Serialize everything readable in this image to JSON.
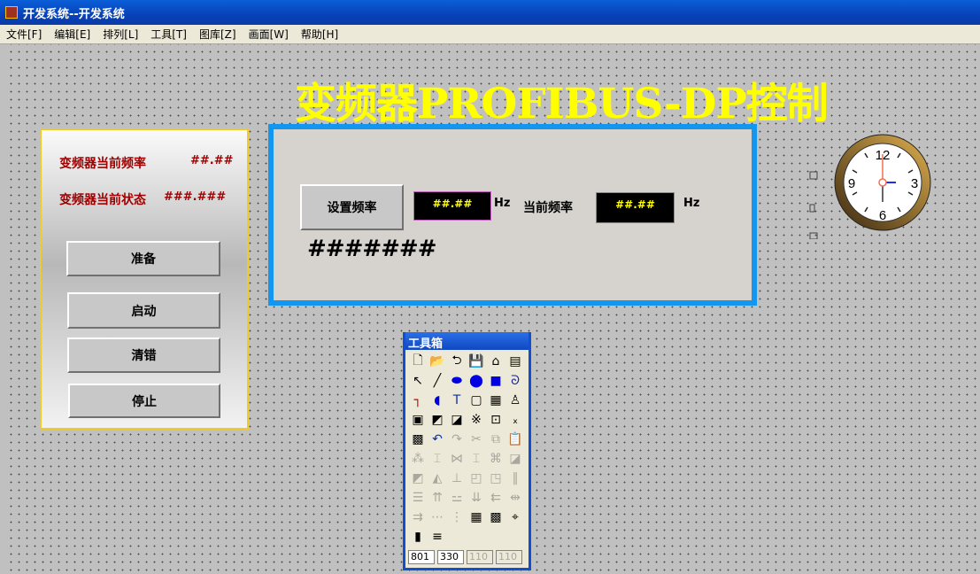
{
  "window": {
    "title": "开发系统--开发系统"
  },
  "menu": [
    "文件[F]",
    "编辑[E]",
    "排列[L]",
    "工具[T]",
    "图库[Z]",
    "画面[W]",
    "帮助[H]"
  ],
  "screen": {
    "title": "变频器PROFIBUS-DP控制"
  },
  "left_panel": {
    "freq_label": "变频器当前频率",
    "freq_value": "##.##",
    "status_label": "变频器当前状态",
    "status_value": "###.###",
    "buttons": [
      "准备",
      "启动",
      "清错",
      "停止"
    ]
  },
  "main_panel": {
    "set_button": "设置频率",
    "set_value": "##.##",
    "unit1": "Hz",
    "current_label": "当前频率",
    "current_value": "##.##",
    "unit2": "Hz",
    "message": "#######"
  },
  "clock": {
    "numbers": [
      "12",
      "3",
      "6",
      "9"
    ]
  },
  "toolbox": {
    "title": "工具箱",
    "fields": [
      "801",
      "330",
      "110",
      "110"
    ],
    "icons": [
      {
        "n": "new-icon",
        "g": "🗋",
        "d": false
      },
      {
        "n": "open-icon",
        "g": "📂",
        "d": true
      },
      {
        "n": "import-icon",
        "g": "⮌",
        "d": false
      },
      {
        "n": "save-icon",
        "g": "💾",
        "d": true
      },
      {
        "n": "screen-icon",
        "g": "⌂",
        "d": false
      },
      {
        "n": "window-icon",
        "g": "▤",
        "d": false
      },
      {
        "n": "pointer-icon",
        "g": "↖",
        "d": false
      },
      {
        "n": "line-icon",
        "g": "╱",
        "d": false
      },
      {
        "n": "ellipse-fill-icon",
        "g": "⬬",
        "d": false
      },
      {
        "n": "circle-icon",
        "g": "⬤",
        "d": false
      },
      {
        "n": "rectangle-icon",
        "g": "■",
        "d": false
      },
      {
        "n": "polyline-icon",
        "g": "ᘐ",
        "d": false
      },
      {
        "n": "pipe-icon",
        "g": "┐",
        "d": false
      },
      {
        "n": "arc-icon",
        "g": "◖",
        "d": false
      },
      {
        "n": "text-icon",
        "g": "T",
        "d": false
      },
      {
        "n": "rounded-rect-icon",
        "g": "▢",
        "d": false
      },
      {
        "n": "report-icon",
        "g": "▦",
        "d": false
      },
      {
        "n": "symbol-icon",
        "g": "♙",
        "d": false
      },
      {
        "n": "library-icon",
        "g": "▣",
        "d": false
      },
      {
        "n": "trend-icon",
        "g": "◩",
        "d": false
      },
      {
        "n": "xy-curve-icon",
        "g": "◪",
        "d": false
      },
      {
        "n": "alarm-icon",
        "g": "※",
        "d": false
      },
      {
        "n": "ocx-icon",
        "g": "⊡",
        "d": false
      },
      {
        "n": "control-icon",
        "g": "ₓ",
        "d": false
      },
      {
        "n": "palette-icon",
        "g": "▩",
        "d": false
      },
      {
        "n": "undo-icon",
        "g": "↶",
        "d": false
      },
      {
        "n": "redo-icon",
        "g": "↷",
        "d": true
      },
      {
        "n": "cut-icon",
        "g": "✂",
        "d": true
      },
      {
        "n": "copy-icon",
        "g": "⧉",
        "d": true
      },
      {
        "n": "paste-icon",
        "g": "📋",
        "d": false
      },
      {
        "n": "group-icon",
        "g": "⁂",
        "d": true
      },
      {
        "n": "ungroup-icon",
        "g": "⌶",
        "d": true
      },
      {
        "n": "combine-icon",
        "g": "⋈",
        "d": true
      },
      {
        "n": "split-icon",
        "g": "⌶",
        "d": true
      },
      {
        "n": "break-icon",
        "g": "⌘",
        "d": true
      },
      {
        "n": "front-icon",
        "g": "◪",
        "d": true
      },
      {
        "n": "back-icon",
        "g": "◩",
        "d": true
      },
      {
        "n": "rotate-icon",
        "g": "◭",
        "d": true
      },
      {
        "n": "align-icon",
        "g": "⊥",
        "d": true
      },
      {
        "n": "overlay-icon",
        "g": "◰",
        "d": true
      },
      {
        "n": "overlay2-icon",
        "g": "◳",
        "d": true
      },
      {
        "n": "center-icon",
        "g": "‖",
        "d": true
      },
      {
        "n": "align-top-icon",
        "g": "☰",
        "d": true
      },
      {
        "n": "align-up-icon",
        "g": "⇈",
        "d": true
      },
      {
        "n": "vcenter-icon",
        "g": "⚍",
        "d": true
      },
      {
        "n": "align-down-icon",
        "g": "⇊",
        "d": true
      },
      {
        "n": "align-left-icon",
        "g": "⇇",
        "d": true
      },
      {
        "n": "hcenter-icon",
        "g": "⇹",
        "d": true
      },
      {
        "n": "align-right-icon",
        "g": "⇉",
        "d": true
      },
      {
        "n": "hspace-icon",
        "g": "⋯",
        "d": true
      },
      {
        "n": "vspace-icon",
        "g": "⋮",
        "d": true
      },
      {
        "n": "grid-icon",
        "g": "▦",
        "d": false
      },
      {
        "n": "color-icon",
        "g": "▩",
        "d": false
      },
      {
        "n": "select-icon",
        "g": "⌖",
        "d": false
      },
      {
        "n": "fill-icon",
        "g": "▮",
        "d": false
      },
      {
        "n": "line-width-icon",
        "g": "≡",
        "d": false
      }
    ]
  }
}
